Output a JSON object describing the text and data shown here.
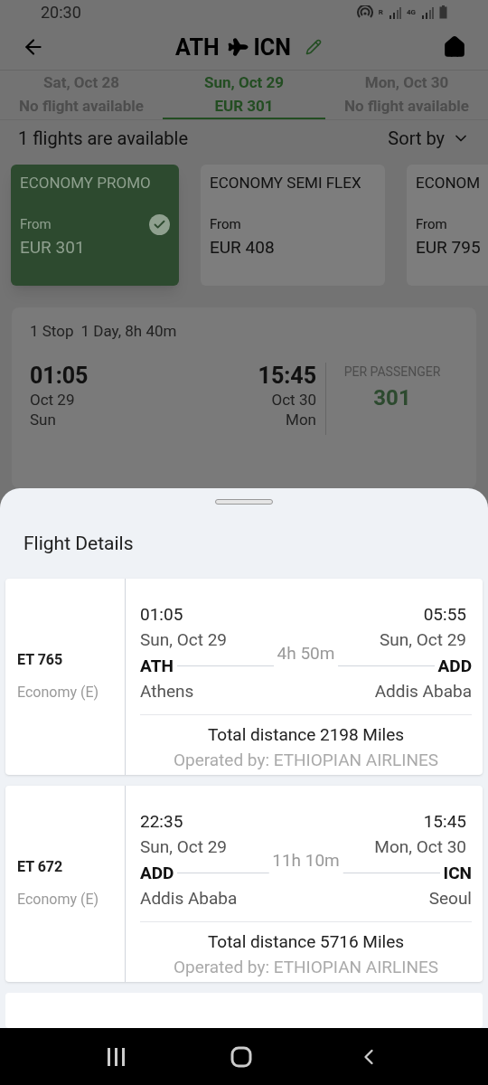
{
  "status_bar": {
    "time": "20:30",
    "net_r": "R",
    "net_4g": "4G"
  },
  "header": {
    "origin": "ATH",
    "destination": "ICN"
  },
  "date_tabs": [
    {
      "date": "Sat, Oct 28",
      "price": "No flight available",
      "selected": false
    },
    {
      "date": "Sun, Oct 29",
      "price": "EUR 301",
      "selected": true
    },
    {
      "date": "Mon, Oct 30",
      "price": "No flight available",
      "selected": false
    }
  ],
  "results": {
    "count": "1 flights are available",
    "sort": "Sort by"
  },
  "fares": [
    {
      "name": "ECONOMY PROMO",
      "from": "From",
      "price": "EUR 301",
      "selected": true
    },
    {
      "name": "ECONOMY SEMI FLEX",
      "from": "From",
      "price": "EUR 408",
      "selected": false
    },
    {
      "name": "ECONOM",
      "from": "From",
      "price": "EUR 795",
      "selected": false
    }
  ],
  "flight": {
    "stops": "1 Stop",
    "duration": "1 Day, 8h 40m",
    "depart_time": "01:05",
    "depart_date": "Oct 29",
    "depart_day": "Sun",
    "arrive_time": "15:45",
    "arrive_date": "Oct 30",
    "arrive_day": "Mon",
    "price_label": "PER PASSENGER",
    "price": "301"
  },
  "sheet": {
    "title": "Flight Details",
    "segments": [
      {
        "flight_no": "ET 765",
        "cabin": "Economy (E)",
        "depart_time": "01:05",
        "depart_date": "Sun, Oct 29",
        "depart_code": "ATH",
        "depart_city": "Athens",
        "arrive_time": "05:55",
        "arrive_date": "Sun, Oct 29",
        "arrive_code": "ADD",
        "arrive_city": "Addis Ababa",
        "duration": "4h 50m",
        "distance": "Total distance 2198 Miles",
        "operator": "Operated by: ETHIOPIAN AIRLINES"
      },
      {
        "flight_no": "ET 672",
        "cabin": "Economy (E)",
        "depart_time": "22:35",
        "depart_date": "Sun, Oct 29",
        "depart_code": "ADD",
        "depart_city": "Addis Ababa",
        "arrive_time": "15:45",
        "arrive_date": "Mon, Oct 30",
        "arrive_code": "ICN",
        "arrive_city": "Seoul",
        "duration": "11h 10m",
        "distance": "Total distance 5716 Miles",
        "operator": "Operated by: ETHIOPIAN AIRLINES"
      }
    ]
  }
}
